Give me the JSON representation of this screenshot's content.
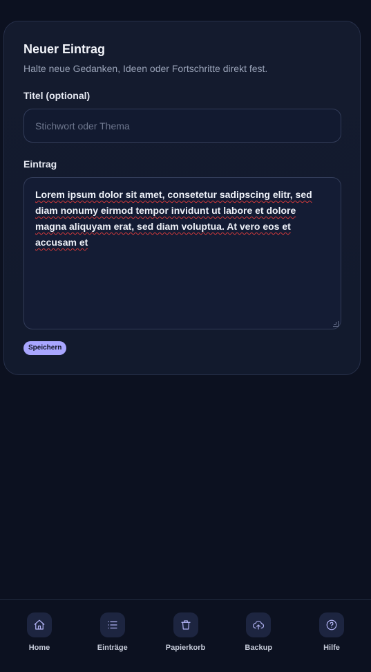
{
  "form": {
    "title": "Neuer Eintrag",
    "subtitle": "Halte neue Gedanken, Ideen oder Fortschritte direkt fest.",
    "title_field": {
      "label": "Titel (optional)",
      "placeholder": "Stichwort oder Thema",
      "value": ""
    },
    "entry_field": {
      "label": "Eintrag",
      "value": "Lorem ipsum dolor sit amet, consetetur sadipscing elitr, sed diam nonumy eirmod tempor invidunt ut labore et dolore magna aliquyam erat, sed diam voluptua. At vero eos et accusam et"
    },
    "save_label": "Speichern"
  },
  "nav": {
    "items": [
      {
        "label": "Home",
        "icon": "home-icon"
      },
      {
        "label": "Einträge",
        "icon": "list-icon"
      },
      {
        "label": "Papierkorb",
        "icon": "trash-icon"
      },
      {
        "label": "Backup",
        "icon": "cloud-upload-icon"
      },
      {
        "label": "Hilfe",
        "icon": "help-circle-icon"
      }
    ]
  },
  "colors": {
    "background": "#0c1120",
    "card": "#141b2e",
    "accent": "#a8a6ff",
    "nav_icon_bg": "#1d2540"
  }
}
